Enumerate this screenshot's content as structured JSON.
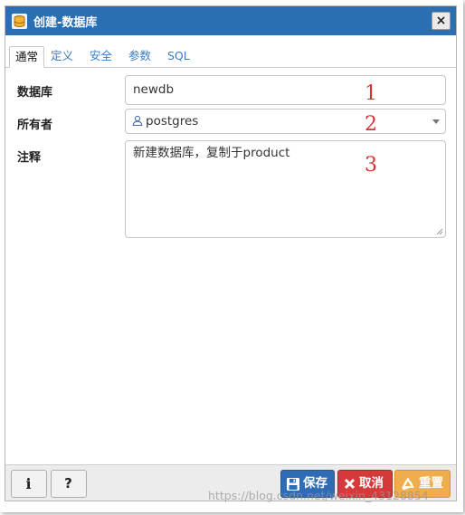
{
  "dialog": {
    "title": "创建-数据库",
    "close_label": "×"
  },
  "tabs": [
    {
      "label": "通常",
      "active": true
    },
    {
      "label": "定义",
      "active": false
    },
    {
      "label": "安全",
      "active": false
    },
    {
      "label": "参数",
      "active": false
    },
    {
      "label": "SQL",
      "active": false
    }
  ],
  "form": {
    "name_label": "数据库",
    "name_value": "newdb",
    "owner_label": "所有者",
    "owner_value": "postgres",
    "comment_label": "注释",
    "comment_value": "新建数据库，复制于product"
  },
  "annotations": [
    "1",
    "2",
    "3"
  ],
  "footer": {
    "info_label": "i",
    "help_label": "?",
    "save_label": "保存",
    "cancel_label": "取消",
    "reset_label": "重置"
  },
  "watermark": "https://blog.csdn.net/weixin_43128854",
  "colors": {
    "titlebar": "#2b6fb3",
    "save": "#2f6cb5",
    "cancel": "#d53a3a",
    "reset": "#f0ad4e",
    "annotation": "#d93030"
  }
}
